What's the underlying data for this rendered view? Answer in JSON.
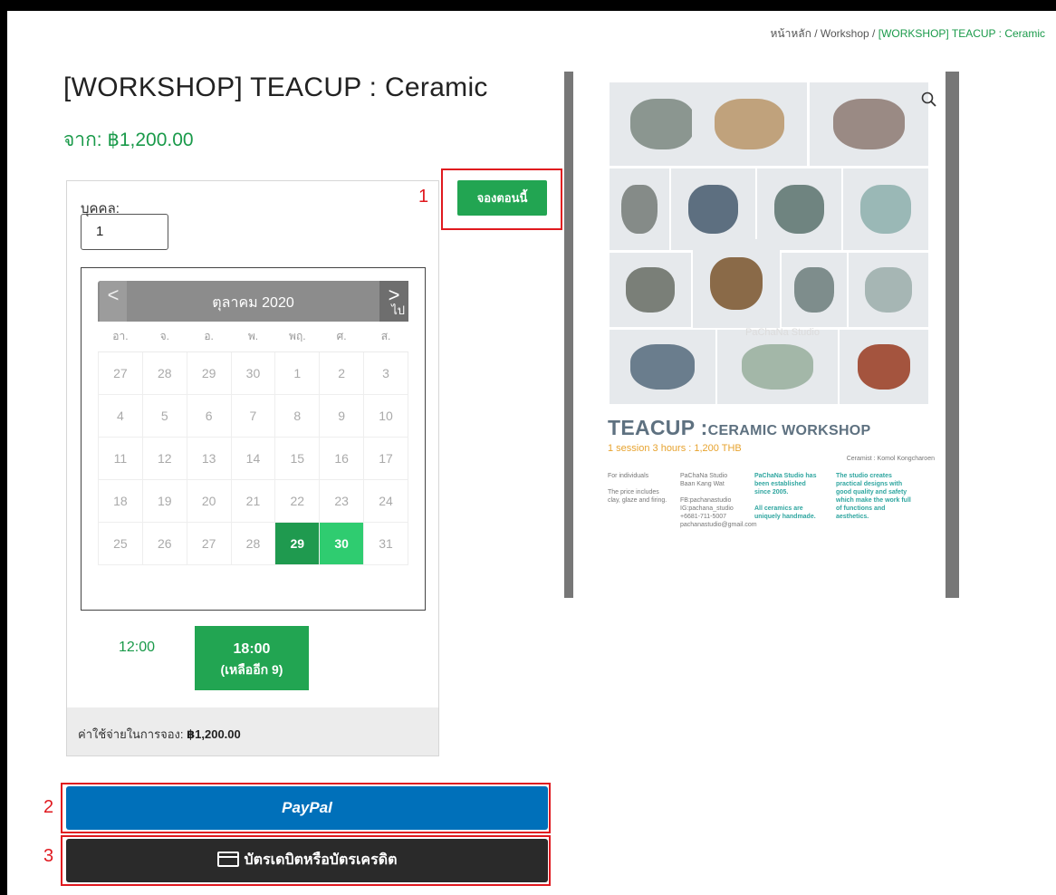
{
  "breadcrumb": {
    "home": "หน้าหลัก",
    "category": "Workshop",
    "current": "[WORKSHOP] TEACUP : Ceramic",
    "separator": "/"
  },
  "product": {
    "title": "[WORKSHOP] TEACUP : Ceramic",
    "price": "จาก: ฿1,200.00"
  },
  "booking": {
    "persons_label": "บุคคล:",
    "persons_value": "1",
    "calendar": {
      "month": "ตุลาคม 2020",
      "prev_icon": "<",
      "next_icon": ">",
      "next_abbr": "ไป",
      "weekdays": [
        "อา.",
        "จ.",
        "อ.",
        "พ.",
        "พฤ.",
        "ศ.",
        "ส."
      ],
      "weeks": [
        [
          "27",
          "28",
          "29",
          "30",
          "1",
          "2",
          "3"
        ],
        [
          "4",
          "5",
          "6",
          "7",
          "8",
          "9",
          "10"
        ],
        [
          "11",
          "12",
          "13",
          "14",
          "15",
          "16",
          "17"
        ],
        [
          "18",
          "19",
          "20",
          "21",
          "22",
          "23",
          "24"
        ],
        [
          "25",
          "26",
          "27",
          "28",
          "29",
          "30",
          "31"
        ]
      ],
      "available_days": [
        "29",
        "30"
      ]
    },
    "time_slots": [
      {
        "time": "12:00"
      },
      {
        "time": "18:00",
        "remaining": "(เหลืออีก 9)"
      }
    ],
    "cost_label": "ค่าใช้จ่ายในการจอง:",
    "cost_value": "฿1,200.00",
    "book_now": "จองตอนนี้"
  },
  "payment": {
    "paypal": "PayPal",
    "card": "บัตรเดบิตหรือบัตรเครดิต"
  },
  "annotations": [
    "1",
    "2",
    "3"
  ],
  "poster": {
    "title_main": "TEACUP :",
    "title_rest": "CERAMIC WORKSHOP",
    "subtitle": "1 session 3 hours : 1,200 THB",
    "ceramist": "Ceramist : Komol Kongcharoen",
    "col1": "For individuals\n\nThe price includes clay, glaze and firing.",
    "col2": "PaChaNa Studio\nBaan Kang Wat\n\nFB:pachanastudio\nIG:pachana_studio\n+6681-711-5007\npachanastudio@gmail.com",
    "col3": "PaChaNa Studio has been established since 2005.\n\nAll ceramics are uniquely handmade.",
    "col4": "The studio creates practical designs with good quality and safety which make the work full of functions and aesthetics.",
    "watermark": "PaChaNa Studio"
  },
  "colors": {
    "green": "#1a9a4a",
    "paypal_blue": "#0070ba",
    "highlight_red": "#e0191f"
  }
}
